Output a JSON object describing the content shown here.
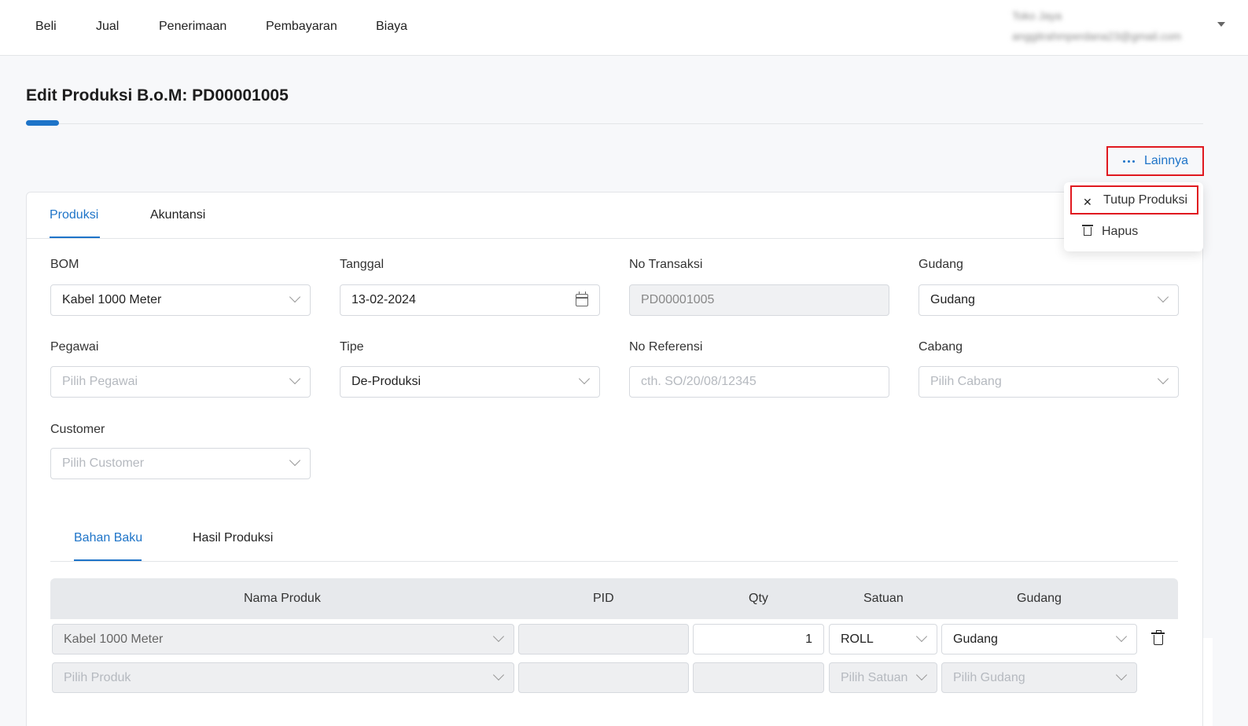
{
  "nav": {
    "items": [
      "Beli",
      "Jual",
      "Penerimaan",
      "Pembayaran",
      "Biaya"
    ]
  },
  "user": {
    "name": "Toko Jaya",
    "email": "anggitrahmperdana23@gmail.com"
  },
  "page": {
    "title": "Edit Produksi B.o.M: PD00001005"
  },
  "more_button": {
    "label": "Lainnya"
  },
  "more_menu": {
    "close_label": "Tutup Produksi",
    "delete_label": "Hapus"
  },
  "tabs": [
    "Produksi",
    "Akuntansi"
  ],
  "form": {
    "bom": {
      "label": "BOM",
      "value": "Kabel 1000 Meter"
    },
    "tanggal": {
      "label": "Tanggal",
      "value": "13-02-2024"
    },
    "no_transaksi": {
      "label": "No Transaksi",
      "value": "PD00001005"
    },
    "gudang": {
      "label": "Gudang",
      "value": "Gudang"
    },
    "pegawai": {
      "label": "Pegawai",
      "placeholder": "Pilih Pegawai"
    },
    "tipe": {
      "label": "Tipe",
      "value": "De-Produksi"
    },
    "no_referensi": {
      "label": "No Referensi",
      "placeholder": "cth. SO/20/08/12345"
    },
    "cabang": {
      "label": "Cabang",
      "placeholder": "Pilih Cabang"
    },
    "customer": {
      "label": "Customer",
      "placeholder": "Pilih Customer"
    }
  },
  "subtabs": [
    "Bahan Baku",
    "Hasil Produksi"
  ],
  "table": {
    "headers": [
      "Nama Produk",
      "PID",
      "Qty",
      "Satuan",
      "Gudang"
    ],
    "row1": {
      "product": "Kabel 1000 Meter",
      "pid": "",
      "qty": "1",
      "unit": "ROLL",
      "warehouse": "Gudang"
    },
    "row2": {
      "product_placeholder": "Pilih Produk",
      "unit_placeholder": "Pilih Satuan",
      "warehouse_placeholder": "Pilih Gudang"
    }
  },
  "colors": {
    "accent": "#1e74c8",
    "highlight_border": "#e0191f"
  }
}
